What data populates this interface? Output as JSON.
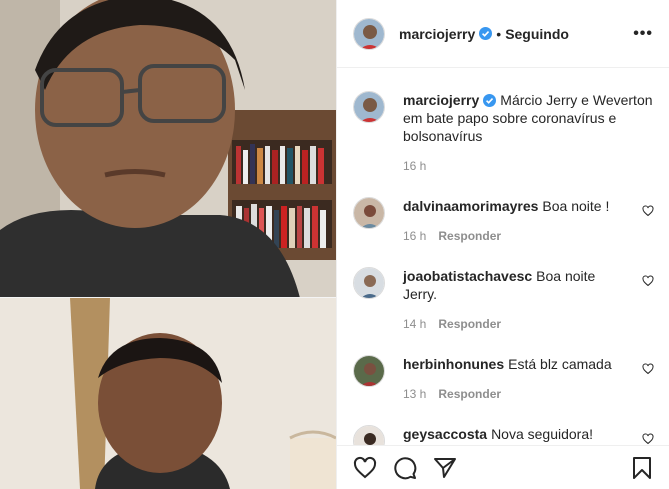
{
  "post": {
    "author": "marciojerry",
    "follow_status": "Seguindo",
    "separator": "•",
    "more": "•••"
  },
  "caption": {
    "author": "marciojerry",
    "text": "Márcio Jerry e Weverton em bate papo sobre coronavírus e bolsonavírus",
    "time": "16 h"
  },
  "comments": [
    {
      "user": "dalvinaamorimayres",
      "text": "Boa noite !",
      "time": "16 h",
      "reply": "Responder"
    },
    {
      "user": "joaobatistachavesc",
      "text": "Boa noite Jerry.",
      "time": "14 h",
      "reply": "Responder"
    },
    {
      "user": "herbinhonunes",
      "text": "Está blz camada",
      "time": "13 h",
      "reply": "Responder"
    },
    {
      "user": "geysaccosta",
      "text": "Nova seguidora!",
      "time": "",
      "reply": ""
    }
  ],
  "icons": {
    "like": "heart-icon",
    "comment": "comment-icon",
    "share": "share-icon",
    "save": "bookmark-icon",
    "verified": "verified-badge-icon"
  },
  "colors": {
    "verified": "#3897f0",
    "muted": "#8e8e8e",
    "text": "#262626"
  }
}
